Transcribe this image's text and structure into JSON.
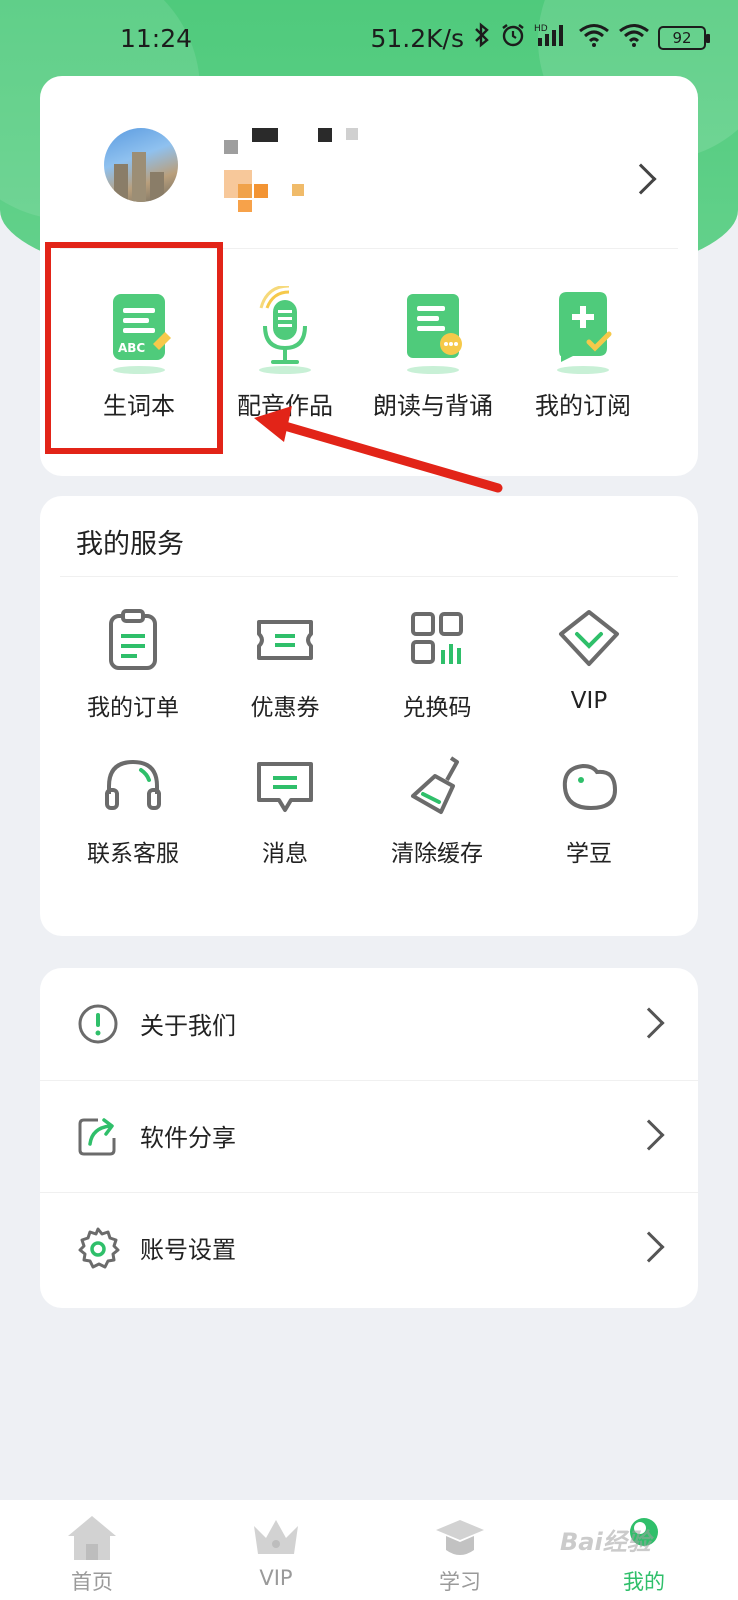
{
  "status_bar": {
    "time": "11:24",
    "net_speed": "51.2K/s",
    "battery": "92",
    "hd_label": "HD"
  },
  "colors": {
    "brand_green": "#4fca7c",
    "accent_green": "#2fbf6a",
    "highlight_red": "#e22418"
  },
  "quick_actions": [
    {
      "label": "生词本",
      "icon": "vocab-book-icon"
    },
    {
      "label": "配音作品",
      "icon": "microphone-icon"
    },
    {
      "label": "朗读与背诵",
      "icon": "reading-book-icon"
    },
    {
      "label": "我的订阅",
      "icon": "subscription-icon"
    }
  ],
  "services": {
    "title": "我的服务",
    "items": [
      {
        "label": "我的订单",
        "icon": "clipboard-icon"
      },
      {
        "label": "优惠券",
        "icon": "coupon-icon"
      },
      {
        "label": "兑换码",
        "icon": "qr-code-icon"
      },
      {
        "label": "VIP",
        "icon": "diamond-icon"
      },
      {
        "label": "联系客服",
        "icon": "headset-icon"
      },
      {
        "label": "消息",
        "icon": "message-icon"
      },
      {
        "label": "清除缓存",
        "icon": "brush-icon"
      },
      {
        "label": "学豆",
        "icon": "bean-icon"
      }
    ]
  },
  "menu": [
    {
      "label": "关于我们",
      "icon": "info-icon"
    },
    {
      "label": "软件分享",
      "icon": "share-icon"
    },
    {
      "label": "账号设置",
      "icon": "gear-icon"
    }
  ],
  "tabs": [
    {
      "label": "首页",
      "icon": "home-icon"
    },
    {
      "label": "VIP",
      "icon": "crown-icon"
    },
    {
      "label": "学习",
      "icon": "graduation-cap-icon"
    },
    {
      "label": "我的",
      "icon": "profile-icon",
      "active": true
    }
  ],
  "watermark": "Bai经验"
}
